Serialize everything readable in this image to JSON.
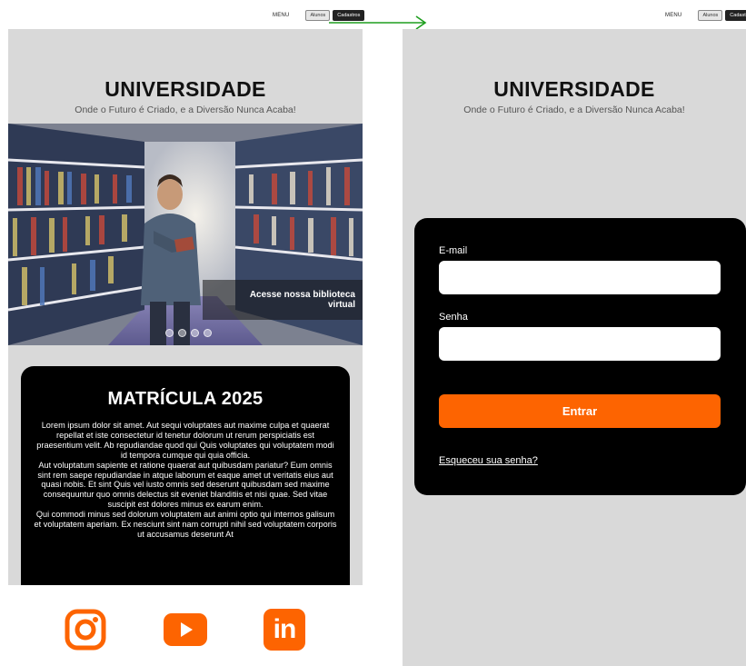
{
  "nav": {
    "menu_label": "MENU",
    "alunos_label": "Alunos",
    "cadastros_label": "Cadastros"
  },
  "header": {
    "title": "UNIVERSIDADE",
    "subtitle": "Onde o Futuro é Criado, e a Diversão Nunca Acaba!"
  },
  "hero": {
    "caption": "Acesse nossa biblioteca virtual",
    "slides": 4,
    "active_slide": 4
  },
  "enrollment": {
    "title": "MATRÍCULA 2025",
    "body": "Lorem ipsum dolor sit amet. Aut sequi voluptates aut maxime culpa et quaerat repellat et iste consectetur id tenetur dolorum ut rerum perspiciatis est praesentium velit. Ab repudiandae quod qui Quis voluptates qui voluptatem modi id tempora cumque qui quia officia.\nAut voluptatum sapiente et ratione quaerat aut quibusdam pariatur? Eum omnis sint rem saepe repudiandae in atque laborum et eaque amet ut veritatis eius aut quasi nobis. Et sint Quis vel iusto omnis sed deserunt quibusdam sed maxime consequuntur quo omnis delectus sit eveniet blanditiis et nisi quae. Sed vitae suscipit est dolores minus ex earum enim.\nQui commodi minus sed dolorum voluptatem aut animi optio qui internos galisum et voluptatem aperiam. Ex nesciunt sint nam corrupti nihil sed voluptatem corporis ut accusamus deserunt At"
  },
  "social": {
    "icons": [
      "instagram-icon",
      "youtube-icon",
      "linkedin-icon"
    ],
    "linkedin_text": "in",
    "color": "#FD6401"
  },
  "login": {
    "email_label": "E-mail",
    "password_label": "Senha",
    "email_value": "",
    "password_value": "",
    "submit_label": "Entrar",
    "forgot_label": "Esqueceu sua senha?"
  },
  "colors": {
    "accent": "#FD6401",
    "card_bg": "#000000",
    "frame_bg": "#D9D9D9",
    "flow_arrow": "#1E9E1E"
  }
}
